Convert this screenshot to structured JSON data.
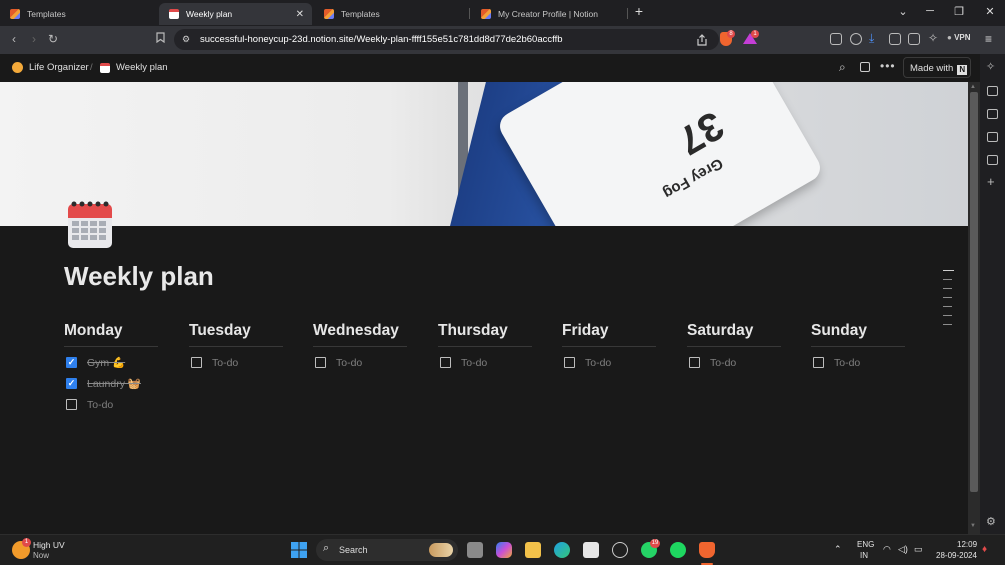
{
  "tabs": [
    {
      "label": "Templates",
      "active": false
    },
    {
      "label": "Weekly plan",
      "active": true
    },
    {
      "label": "Templates",
      "active": false
    },
    {
      "label": "My Creator Profile | Notion",
      "active": false
    }
  ],
  "address_bar": {
    "url": "successful-honeycup-23d.notion.site/Weekly-plan-ffff155e51c781dd8d77de2b60accffb"
  },
  "extensions": {
    "vpn_label": "VPN",
    "brave_badge": "8",
    "alert_badge": "1"
  },
  "notion_header": {
    "breadcrumb": [
      "Life Organizer",
      "Weekly plan"
    ],
    "breadcrumb_sep": "/",
    "made_with_label": "Made with",
    "notion_logo": "N"
  },
  "cover": {
    "card_number": "37",
    "card_name": "Grey Fog"
  },
  "page": {
    "title": "Weekly plan",
    "icon": "calendar-icon",
    "days": [
      {
        "name": "Monday",
        "todos": [
          {
            "label": "Gym 💪",
            "checked": true
          },
          {
            "label": "Laundry 🧺",
            "checked": true
          },
          {
            "label": "To-do",
            "checked": false
          }
        ]
      },
      {
        "name": "Tuesday",
        "todos": [
          {
            "label": "To-do",
            "checked": false
          }
        ]
      },
      {
        "name": "Wednesday",
        "todos": [
          {
            "label": "To-do",
            "checked": false
          }
        ]
      },
      {
        "name": "Thursday",
        "todos": [
          {
            "label": "To-do",
            "checked": false
          }
        ]
      },
      {
        "name": "Friday",
        "todos": [
          {
            "label": "To-do",
            "checked": false
          }
        ]
      },
      {
        "name": "Saturday",
        "todos": [
          {
            "label": "To-do",
            "checked": false
          }
        ]
      },
      {
        "name": "Sunday",
        "todos": [
          {
            "label": "To-do",
            "checked": false
          }
        ]
      }
    ]
  },
  "taskbar": {
    "weather": {
      "title": "High UV",
      "subtitle": "Now",
      "badge": "1"
    },
    "search_label": "Search",
    "whatsapp_badge": "19",
    "language": {
      "line1": "ENG",
      "line2": "IN"
    },
    "clock": {
      "time": "12:09",
      "date": "28-09-2024"
    }
  },
  "colors": {
    "accent_checkbox": "#2f80ed",
    "page_bg": "#191919"
  }
}
